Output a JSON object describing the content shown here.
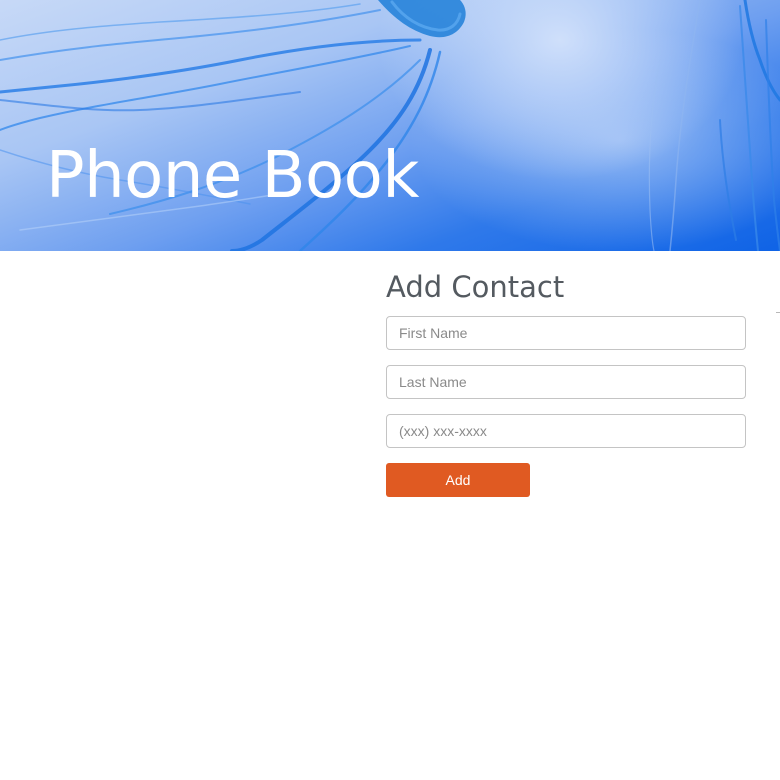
{
  "header": {
    "title": "Phone Book",
    "background": "jellyfish-photo",
    "accent": "#1d6fe8"
  },
  "add_contact": {
    "heading": "Add Contact",
    "first_name": {
      "value": "",
      "placeholder": "First Name"
    },
    "last_name": {
      "value": "",
      "placeholder": "Last Name"
    },
    "phone": {
      "value": "",
      "placeholder": "(xxx) xxx-xxxx"
    },
    "submit_label": "Add",
    "button_color": "#e05a22"
  }
}
